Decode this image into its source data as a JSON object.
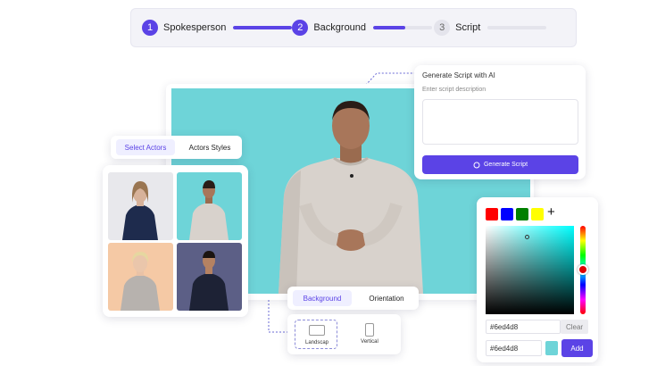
{
  "steps": [
    {
      "num": "1",
      "label": "Spokesperson",
      "progress": 1.0,
      "active": true
    },
    {
      "num": "2",
      "label": "Background",
      "progress": 0.55,
      "active": true
    },
    {
      "num": "3",
      "label": "Script",
      "progress": 0.0,
      "active": false
    }
  ],
  "script_panel": {
    "title": "Generate Script with AI",
    "placeholder": "Enter script description",
    "button_label": "Generate Script"
  },
  "actor_tabs": {
    "select": "Select Actors",
    "styles": "Actors Styles"
  },
  "bg_tabs": {
    "background": "Background",
    "orientation": "Orientation"
  },
  "orientation_options": [
    {
      "label": "Landscap"
    },
    {
      "label": "Vertical"
    }
  ],
  "color_picker": {
    "swatches": [
      "#ff0000",
      "#0000ff",
      "#008000",
      "#ffff00"
    ],
    "add_symbol": "+",
    "hex_value": "#6ed4d8",
    "clear_label": "Clear",
    "hex_value_2": "#6ed4d8",
    "add_label": "Add"
  },
  "colors": {
    "accent": "#5b43e6",
    "canvas_bg": "#6ed4d8"
  }
}
